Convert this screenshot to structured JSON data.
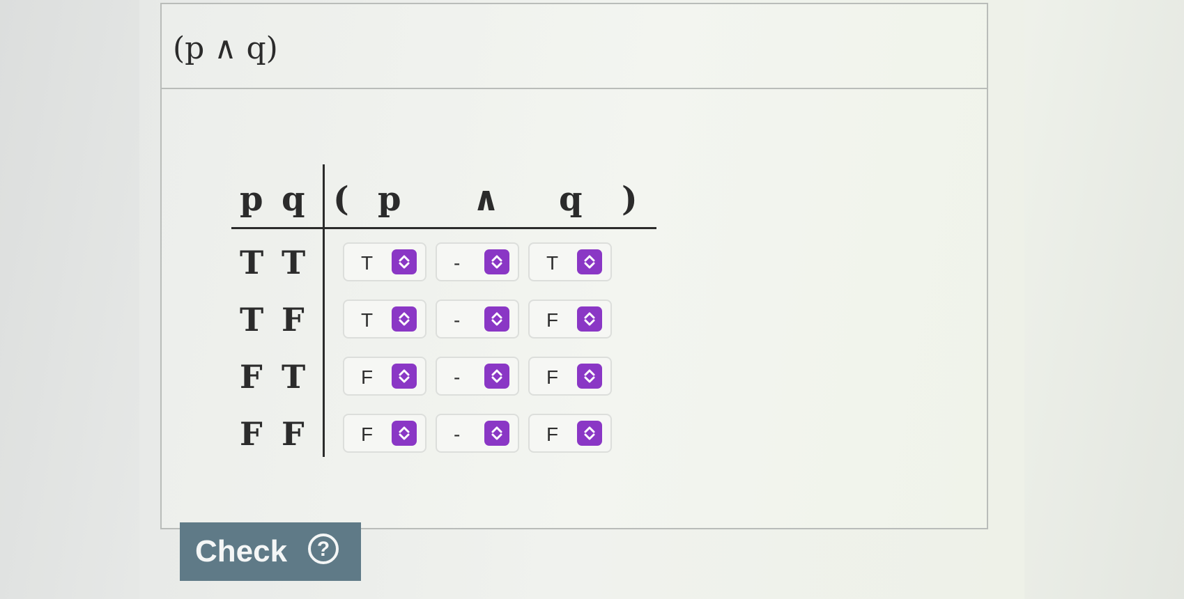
{
  "question": {
    "title": "(p ∧ q)"
  },
  "table": {
    "headers": {
      "p": "p",
      "q": "q",
      "open_paren": "(",
      "expr_p": "p",
      "expr_and": "∧",
      "expr_q": "q",
      "close_paren": ")"
    },
    "rows": [
      {
        "p": "T",
        "q": "T",
        "sel_p": "T",
        "sel_op": "-",
        "sel_q": "T"
      },
      {
        "p": "T",
        "q": "F",
        "sel_p": "T",
        "sel_op": "-",
        "sel_q": "F"
      },
      {
        "p": "F",
        "q": "T",
        "sel_p": "F",
        "sel_op": "-",
        "sel_q": "F"
      },
      {
        "p": "F",
        "q": "F",
        "sel_p": "F",
        "sel_op": "-",
        "sel_q": "F"
      }
    ]
  },
  "check_button": {
    "label": "Check",
    "help_glyph": "?"
  },
  "colors": {
    "select_accent": "#8a37c5",
    "check_button_bg": "#5f7a87"
  },
  "icons": {
    "select_arrows": "chevron-up-down-icon",
    "help": "question-circle-icon"
  }
}
